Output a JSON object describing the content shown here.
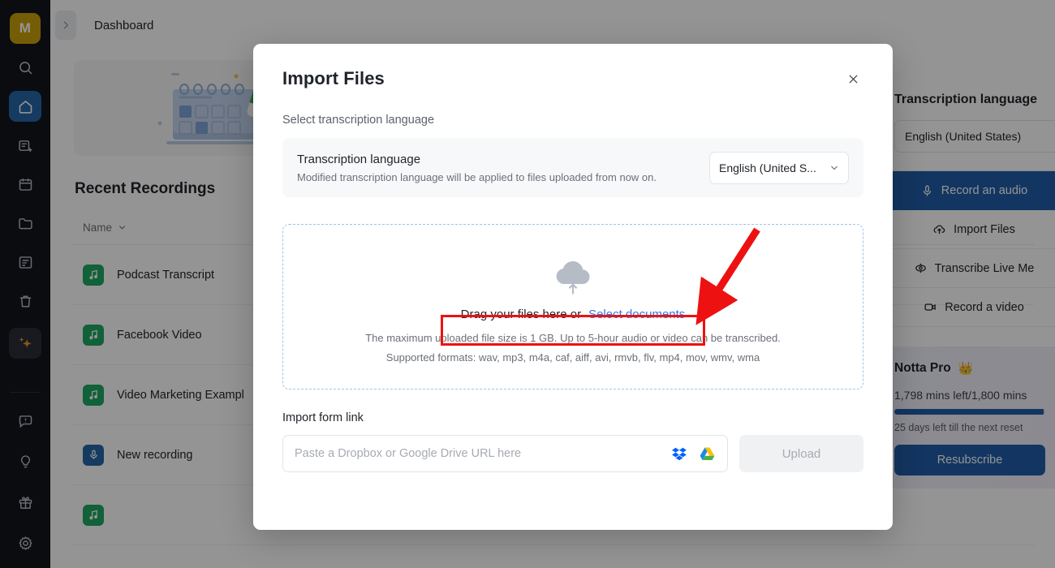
{
  "sidebar": {
    "avatar_label": "M",
    "items": [
      {
        "name": "search-icon",
        "label": "Search"
      },
      {
        "name": "home-icon",
        "label": "Home",
        "active": true
      },
      {
        "name": "new-note-icon",
        "label": "New note"
      },
      {
        "name": "calendar-icon",
        "label": "Calendar"
      },
      {
        "name": "folder-icon",
        "label": "Folders"
      },
      {
        "name": "list-icon",
        "label": "Templates"
      },
      {
        "name": "trash-icon",
        "label": "Trash"
      },
      {
        "name": "ai-sparkle-icon",
        "label": "AI Assistant"
      }
    ],
    "bottom_items": [
      {
        "name": "feedback-icon",
        "label": "Feedback"
      },
      {
        "name": "lightbulb-icon",
        "label": "Tips"
      },
      {
        "name": "gift-icon",
        "label": "Rewards"
      },
      {
        "name": "settings-icon",
        "label": "Settings"
      }
    ]
  },
  "topbar": {
    "breadcrumb": "Dashboard"
  },
  "recordings": {
    "section_title": "Recent Recordings",
    "column_header": "Name",
    "rows": [
      {
        "name": "Podcast Transcript",
        "icon": "audio"
      },
      {
        "name": "Facebook Video",
        "icon": "audio"
      },
      {
        "name": "Video Marketing Exampl",
        "icon": "audio"
      },
      {
        "name": "New recording",
        "icon": "mic"
      }
    ]
  },
  "right_panel": {
    "title": "Transcription language",
    "language_value": "English (United States)",
    "actions": [
      {
        "label": "Record an audio",
        "icon": "mic-icon",
        "primary": true
      },
      {
        "label": "Import Files",
        "icon": "cloud-upload-icon",
        "primary": false
      },
      {
        "label": "Transcribe Live Me",
        "icon": "live-meeting-icon",
        "primary": false
      },
      {
        "label": "Record a video",
        "icon": "video-camera-icon",
        "primary": false
      }
    ],
    "plan": {
      "name": "Notta Pro",
      "crown": "👑",
      "minutes": "1,798 mins left/1,800 mins",
      "progress_percent": 99,
      "reset_note": "25 days left till the next reset",
      "cta": "Resubscribe"
    }
  },
  "modal": {
    "title": "Import Files",
    "close_label": "×",
    "subtitle": "Select transcription language",
    "language_row": {
      "title": "Transcription language",
      "description": "Modified transcription language will be applied to files uploaded from now on.",
      "selected": "English (United S...",
      "options": [
        "English (United States)"
      ]
    },
    "dropzone": {
      "prompt": "Drag your files here or",
      "link": "Select documents",
      "note_size": "The maximum uploaded file size is 1 GB. Up to 5-hour audio or video can be transcribed.",
      "note_formats": "Supported formats: wav, mp3, m4a, caf, aiff, avi, rmvb, flv, mp4, mov, wmv, wma"
    },
    "import_link": {
      "label": "Import form link",
      "placeholder": "Paste a Dropbox or Google Drive URL here",
      "upload_label": "Upload",
      "services": [
        "dropbox-icon",
        "google-drive-icon"
      ]
    }
  },
  "annotation": {
    "color": "#ee1111",
    "highlight_target": "Drag your files here or Select documents",
    "arrow": "points to highlighted drag-and-drop prompt"
  },
  "colors": {
    "accent_blue": "#1f5da8",
    "rail_bg": "#13161c",
    "avatar_gold": "#c8a00b",
    "ai_orange": "#e8952a",
    "link_blue": "#2f7ae5",
    "annotation_red": "#ee1111",
    "audio_green": "#1ea762"
  }
}
